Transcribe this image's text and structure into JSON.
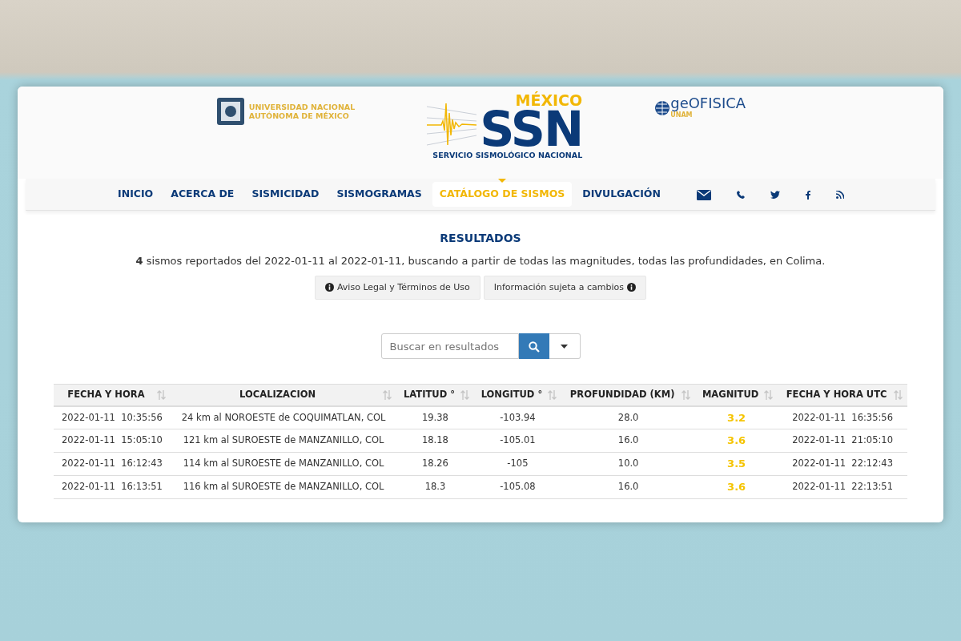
{
  "header": {
    "unam_logo": [
      "UNIVERSIDAD NACIONAL",
      "AUTÓNOMA DE MÉXICO"
    ],
    "ssn_logo": {
      "country": "MÉXICO",
      "acronym": "SSN",
      "name": "SERVICIO SISMOLÓGICO NACIONAL"
    },
    "geofisica_logo": {
      "name": "geOFISICA",
      "sub": "UNAM"
    }
  },
  "nav": [
    {
      "label": "INICIO",
      "selected": false
    },
    {
      "label": "ACERCA DE",
      "selected": false
    },
    {
      "label": "SISMICIDAD",
      "selected": false
    },
    {
      "label": "SISMOGRAMAS",
      "selected": false
    },
    {
      "label": "CATÁLOGO DE SISMOS",
      "selected": true
    },
    {
      "label": "DIVULGACIÓN",
      "selected": false
    }
  ],
  "results": {
    "title": "RESULTADOS",
    "summary": "**4** sismos reportados del 2022-01-11 al 2022-01-11, buscando a partir de todas las magnitudes, todas las profundidades, en Colima.",
    "buttons": [
      {
        "label": "Aviso Legal y Términos de Uso",
        "kind": "leading"
      },
      {
        "label": "Información sujeta a cambios",
        "kind": "trailing"
      }
    ]
  },
  "search": {
    "placeholder": "Buscar en resultados"
  },
  "table": {
    "columns": [
      "FECHA Y HORA",
      "LOCALIZACION",
      "LATITUD °",
      "LONGITUD °",
      "PROFUNDIDAD (KM)",
      "MAGNITUD",
      "FECHA Y HORA UTC"
    ],
    "rows": [
      [
        "2022-01-11  10:35:56",
        "24 km al NOROESTE de COQUIMATLAN, COL",
        "19.38",
        "-103.94",
        "28.0",
        "3.2",
        "2022-01-11  16:35:56"
      ],
      [
        "2022-01-11  15:05:10",
        "121 km al SUROESTE de MANZANILLO, COL",
        "18.18",
        "-105.01",
        "16.0",
        "3.6",
        "2022-01-11  21:05:10"
      ],
      [
        "2022-01-11  16:12:43",
        "114 km al SUROESTE de MANZANILLO, COL",
        "18.26",
        "-105",
        "10.0",
        "3.5",
        "2022-01-11  22:12:43"
      ],
      [
        "2022-01-11  16:13:51",
        "116 km al SUROESTE de MANZANILLO, COL",
        "18.3",
        "-105.08",
        "16.0",
        "3.6",
        "2022-01-11  22:13:51"
      ]
    ]
  }
}
